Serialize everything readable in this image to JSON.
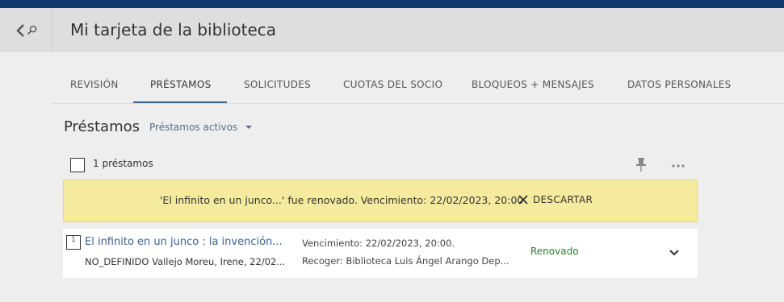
{
  "header": {
    "title": "Mi tarjeta de la biblioteca"
  },
  "tabs": [
    {
      "label": "REVISIÓN"
    },
    {
      "label": "PRÉSTAMOS"
    },
    {
      "label": "SOLICITUDES"
    },
    {
      "label": "CUOTAS DEL SOCIO"
    },
    {
      "label": "BLOQUEOS + MENSAJES"
    },
    {
      "label": "DATOS PERSONALES"
    }
  ],
  "section": {
    "title": "Préstamos",
    "filter": "Préstamos activos"
  },
  "toolbar": {
    "count": "1 préstamos"
  },
  "alert": {
    "message": "'El infinito en un junco...' fue renovado. Vencimiento: 22/02/2023, 20:00",
    "dismiss": "DESCARTAR"
  },
  "loans": [
    {
      "index": "1",
      "title": "El infinito en un junco : la invención...",
      "author": "NO_DEFINIDO Vallejo Moreu, Irene, 22/02...",
      "due": "Vencimiento: 22/02/2023, 20:00.",
      "pickup": "Recoger: Biblioteca Luis Ángel Arango Dep...",
      "status": "Renovado"
    }
  ],
  "colors": {
    "topbar": "#0f3b6f",
    "accent": "#3c6090",
    "alert_bg": "#f5eb9f",
    "status_ok": "#2d7a2d"
  },
  "icons": [
    "back-arrow-icon",
    "search-icon",
    "pin-icon",
    "more-icon",
    "close-icon",
    "chevron-down-icon",
    "caret-down-icon"
  ]
}
